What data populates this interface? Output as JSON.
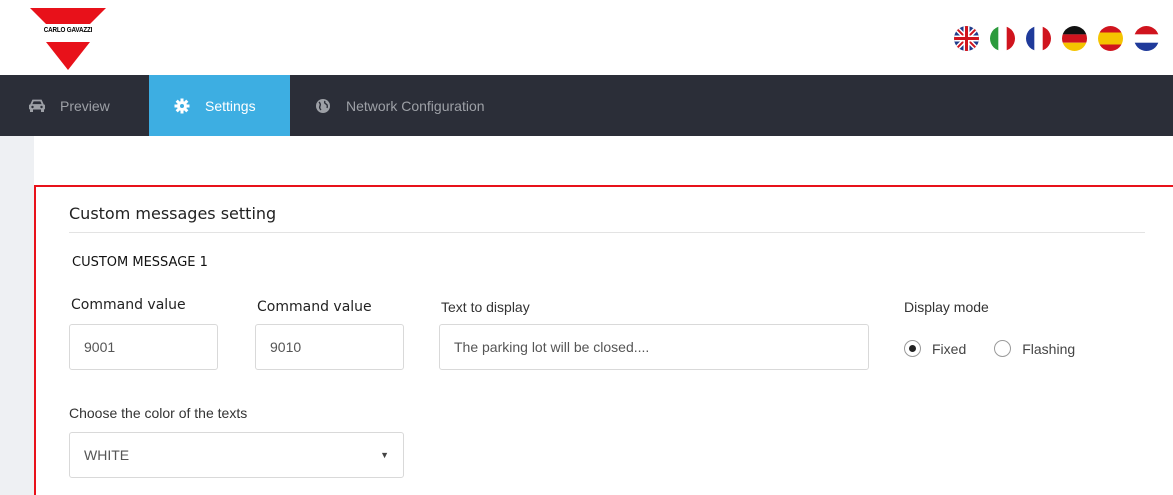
{
  "brand": {
    "logo_text": "CARLO GAVAZZI",
    "color": "#e8111a"
  },
  "languages": [
    {
      "name": "uk-flag-icon"
    },
    {
      "name": "italy-flag-icon"
    },
    {
      "name": "france-flag-icon"
    },
    {
      "name": "germany-flag-icon"
    },
    {
      "name": "spain-flag-icon"
    },
    {
      "name": "netherlands-flag-icon"
    }
  ],
  "nav": {
    "items": [
      {
        "label": "Preview",
        "icon": "car-icon"
      },
      {
        "label": "Settings",
        "icon": "gear-icon",
        "active": true
      },
      {
        "label": "Network Configuration",
        "icon": "globe-icon"
      }
    ],
    "background": "#2b2e38",
    "active_color": "#3daee2"
  },
  "panel": {
    "title": "Custom messages setting",
    "subheading": "CUSTOM MESSAGE 1",
    "command_value_1": {
      "label": "Command value",
      "value": "9001"
    },
    "command_value_2": {
      "label": "Command value",
      "value": "9010"
    },
    "text_to_display": {
      "label": "Text to display",
      "value": "The parking lot will be closed...."
    },
    "display_mode": {
      "label": "Display mode",
      "options": [
        "Fixed",
        "Flashing"
      ],
      "selected": "Fixed"
    },
    "color_select": {
      "label": "Choose the color of the texts",
      "value": "WHITE"
    }
  }
}
